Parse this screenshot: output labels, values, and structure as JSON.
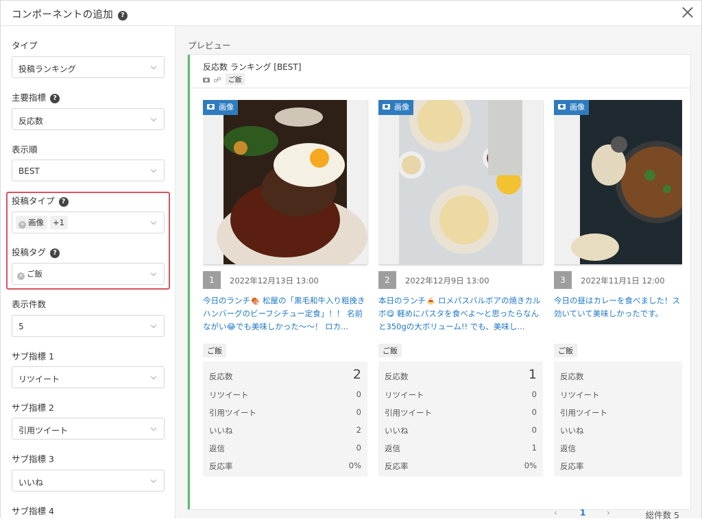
{
  "header": {
    "title": "コンポーネントの追加",
    "help": "?"
  },
  "form": {
    "type": {
      "label": "タイプ",
      "value": "投稿ランキング"
    },
    "main_metric": {
      "label": "主要指標",
      "value": "反応数"
    },
    "order": {
      "label": "表示順",
      "value": "BEST"
    },
    "post_type": {
      "label": "投稿タイプ",
      "tag": "画像",
      "more": "+1"
    },
    "post_tag": {
      "label": "投稿タグ",
      "tag": "ご飯"
    },
    "count": {
      "label": "表示件数",
      "value": "5"
    },
    "sub1": {
      "label": "サブ指標 1",
      "value": "リツイート"
    },
    "sub2": {
      "label": "サブ指標 2",
      "value": "引用ツイート"
    },
    "sub3": {
      "label": "サブ指標 3",
      "value": "いいね"
    },
    "sub4": {
      "label": "サブ指標 4"
    }
  },
  "preview": {
    "label": "プレビュー",
    "title": "反応数 ランキング [BEST]",
    "tag": "ご飯",
    "badge": "画像",
    "stat_labels": [
      "反応数",
      "リツイート",
      "引用ツイート",
      "いいね",
      "返信",
      "反応率"
    ],
    "cards": [
      {
        "rank": "1",
        "date": "2022年12月13日 13:00",
        "text": "今日のランチ🍖 松屋の「黒毛和牛入り粗挽きハンバーグのビーフシチュー定食」！！ 名前ながい😂でも美味しかった〜〜！ ロカ...",
        "tag": "ご飯",
        "stats": [
          "2",
          "0",
          "0",
          "2",
          "0",
          "0%"
        ]
      },
      {
        "rank": "2",
        "date": "2022年12月9日 13:00",
        "text": "本日のランチ🍝 ロメパスバルボアの焼きカルボ😋 軽めにパスタを食べよ〜と思ったらなんと350gの大ボリューム!! でも、美味し...",
        "tag": "ご飯",
        "stats": [
          "1",
          "0",
          "0",
          "0",
          "1",
          "0%"
        ]
      },
      {
        "rank": "3",
        "date": "2022年11月1日 12:00",
        "text": "今日の昼はカレーを食べました！ス効いていて美味しかったです。",
        "tag": "ご飯",
        "stats": [
          "",
          "",
          "",
          "",
          "",
          ""
        ]
      }
    ],
    "pagination": {
      "prev": "‹",
      "page": "1",
      "next": "›"
    },
    "total": "総件数 5"
  }
}
